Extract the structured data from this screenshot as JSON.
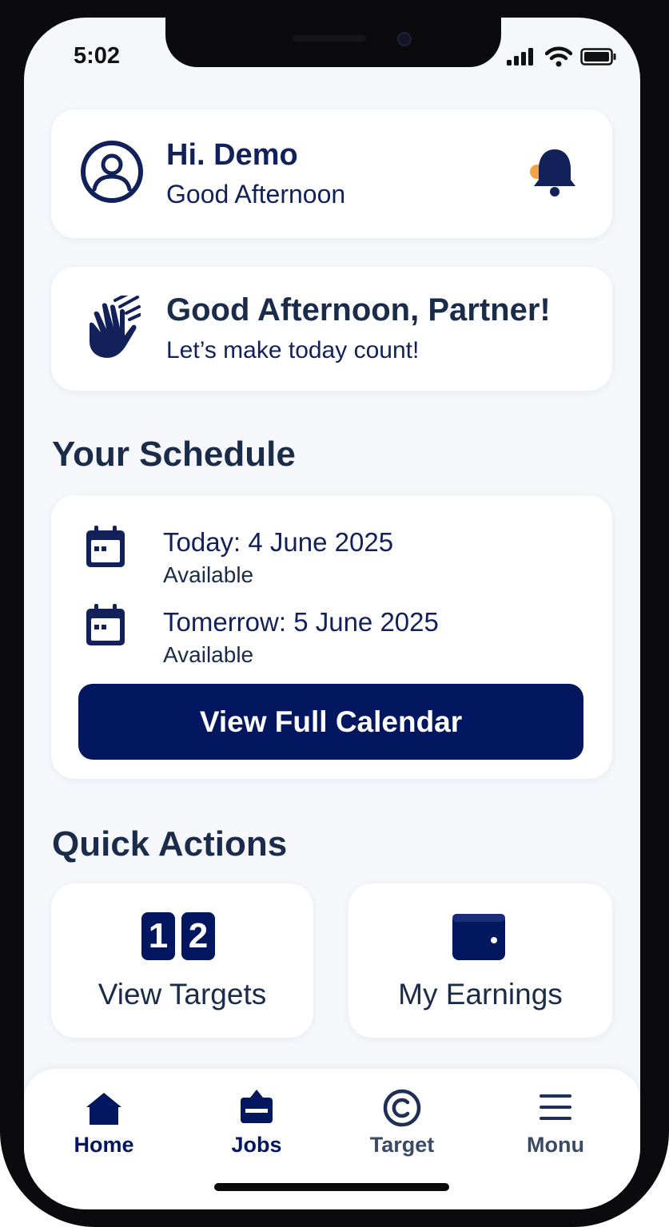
{
  "status_bar": {
    "time": "5:02",
    "signal_icon": "signal-icon",
    "wifi_icon": "wifi-icon",
    "battery_icon": "battery-icon"
  },
  "greeting_card": {
    "title": "Hi. Demo",
    "subtitle": "Good Afternoon",
    "avatar_icon": "user-circle-icon",
    "notification_icon": "bell-icon"
  },
  "welcome_card": {
    "title": "Good Afternoon, Partner!",
    "subtitle": "Let’s make today count!",
    "icon": "waving-hand-icon"
  },
  "schedule": {
    "title": "Your Schedule",
    "items": [
      {
        "date": "Today: 4 June 2025",
        "status": "Available",
        "icon": "calendar-icon"
      },
      {
        "date": "Tomerrow: 5 June 2025",
        "status": "Available",
        "icon": "calendar-icon"
      }
    ],
    "button_label": "View Full Calendar"
  },
  "quick_actions": {
    "title": "Quick Actions",
    "items": [
      {
        "label": "View Targets",
        "icon": "number-blocks-icon",
        "digits": [
          "1",
          "2"
        ]
      },
      {
        "label": "My Earnings",
        "icon": "wallet-icon"
      }
    ]
  },
  "bottom_nav": {
    "items": [
      {
        "label": "Home",
        "icon": "home-icon",
        "active": true
      },
      {
        "label": "Jobs",
        "icon": "briefcase-icon",
        "active": false
      },
      {
        "label": "Target",
        "icon": "copyright-icon",
        "active": false
      },
      {
        "label": "Monu",
        "icon": "hamburger-menu-icon",
        "active": false
      }
    ]
  },
  "colors": {
    "primary": "#02175f",
    "text_dark": "#13215a",
    "heading": "#1b2c4a",
    "inactive_nav": "#3a4a66",
    "background": "#f5f7fb",
    "accent_orange": "#f5a340"
  }
}
